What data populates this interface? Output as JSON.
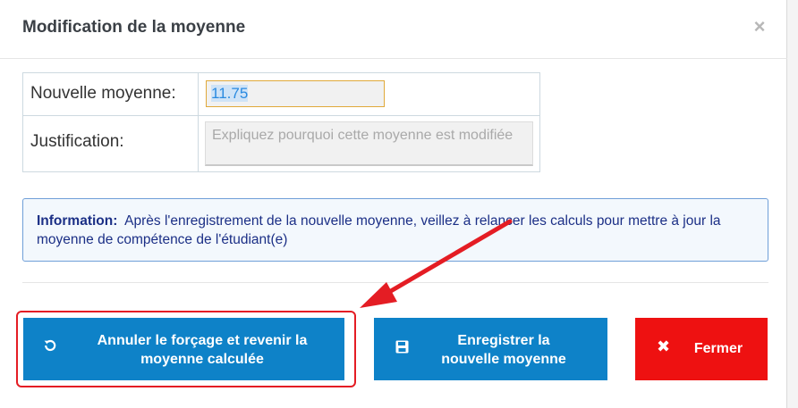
{
  "dialog": {
    "title": "Modification de la moyenne",
    "close_icon": "×"
  },
  "form": {
    "moyenne_label": "Nouvelle moyenne:",
    "moyenne_value": "11.75",
    "justification_label": "Justification:",
    "justification_placeholder": "Expliquez pourquoi cette moyenne est modifiée"
  },
  "info": {
    "label": "Information:",
    "text": "Après l'enregistrement de la nouvelle moyenne, veillez à relancer les calculs pour mettre à jour la moyenne de compétence de l'étudiant(e)"
  },
  "buttons": {
    "cancel_label": "Annuler le forçage et revenir la moyenne calculée",
    "cancel_icon": "undo-icon",
    "save_label": "Enregistrer la nouvelle moyenne",
    "save_icon": "floppy-disk-icon",
    "close_label": "Fermer",
    "close_icon": "x-icon"
  },
  "colors": {
    "primary_button": "#0e82c8",
    "danger_button": "#ee1111",
    "annotation": "#e41d24",
    "info_text": "#1b2f86"
  }
}
